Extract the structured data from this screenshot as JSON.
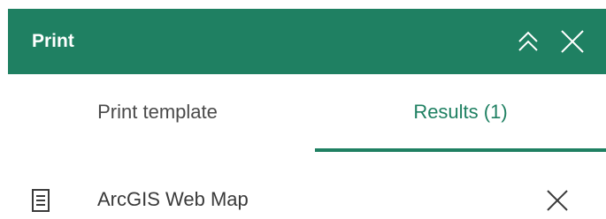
{
  "header": {
    "title": "Print",
    "collapse_icon": "double-chevron-up-icon",
    "close_icon": "close-icon"
  },
  "tabs": [
    {
      "label": "Print template",
      "active": false
    },
    {
      "label": "Results (1)",
      "active": true
    }
  ],
  "results": [
    {
      "icon": "document-icon",
      "label": "ArcGIS Web Map",
      "remove_icon": "close-icon"
    }
  ],
  "colors": {
    "accent": "#1f8062",
    "text": "#3a3a3a",
    "header_text": "#ffffff"
  }
}
